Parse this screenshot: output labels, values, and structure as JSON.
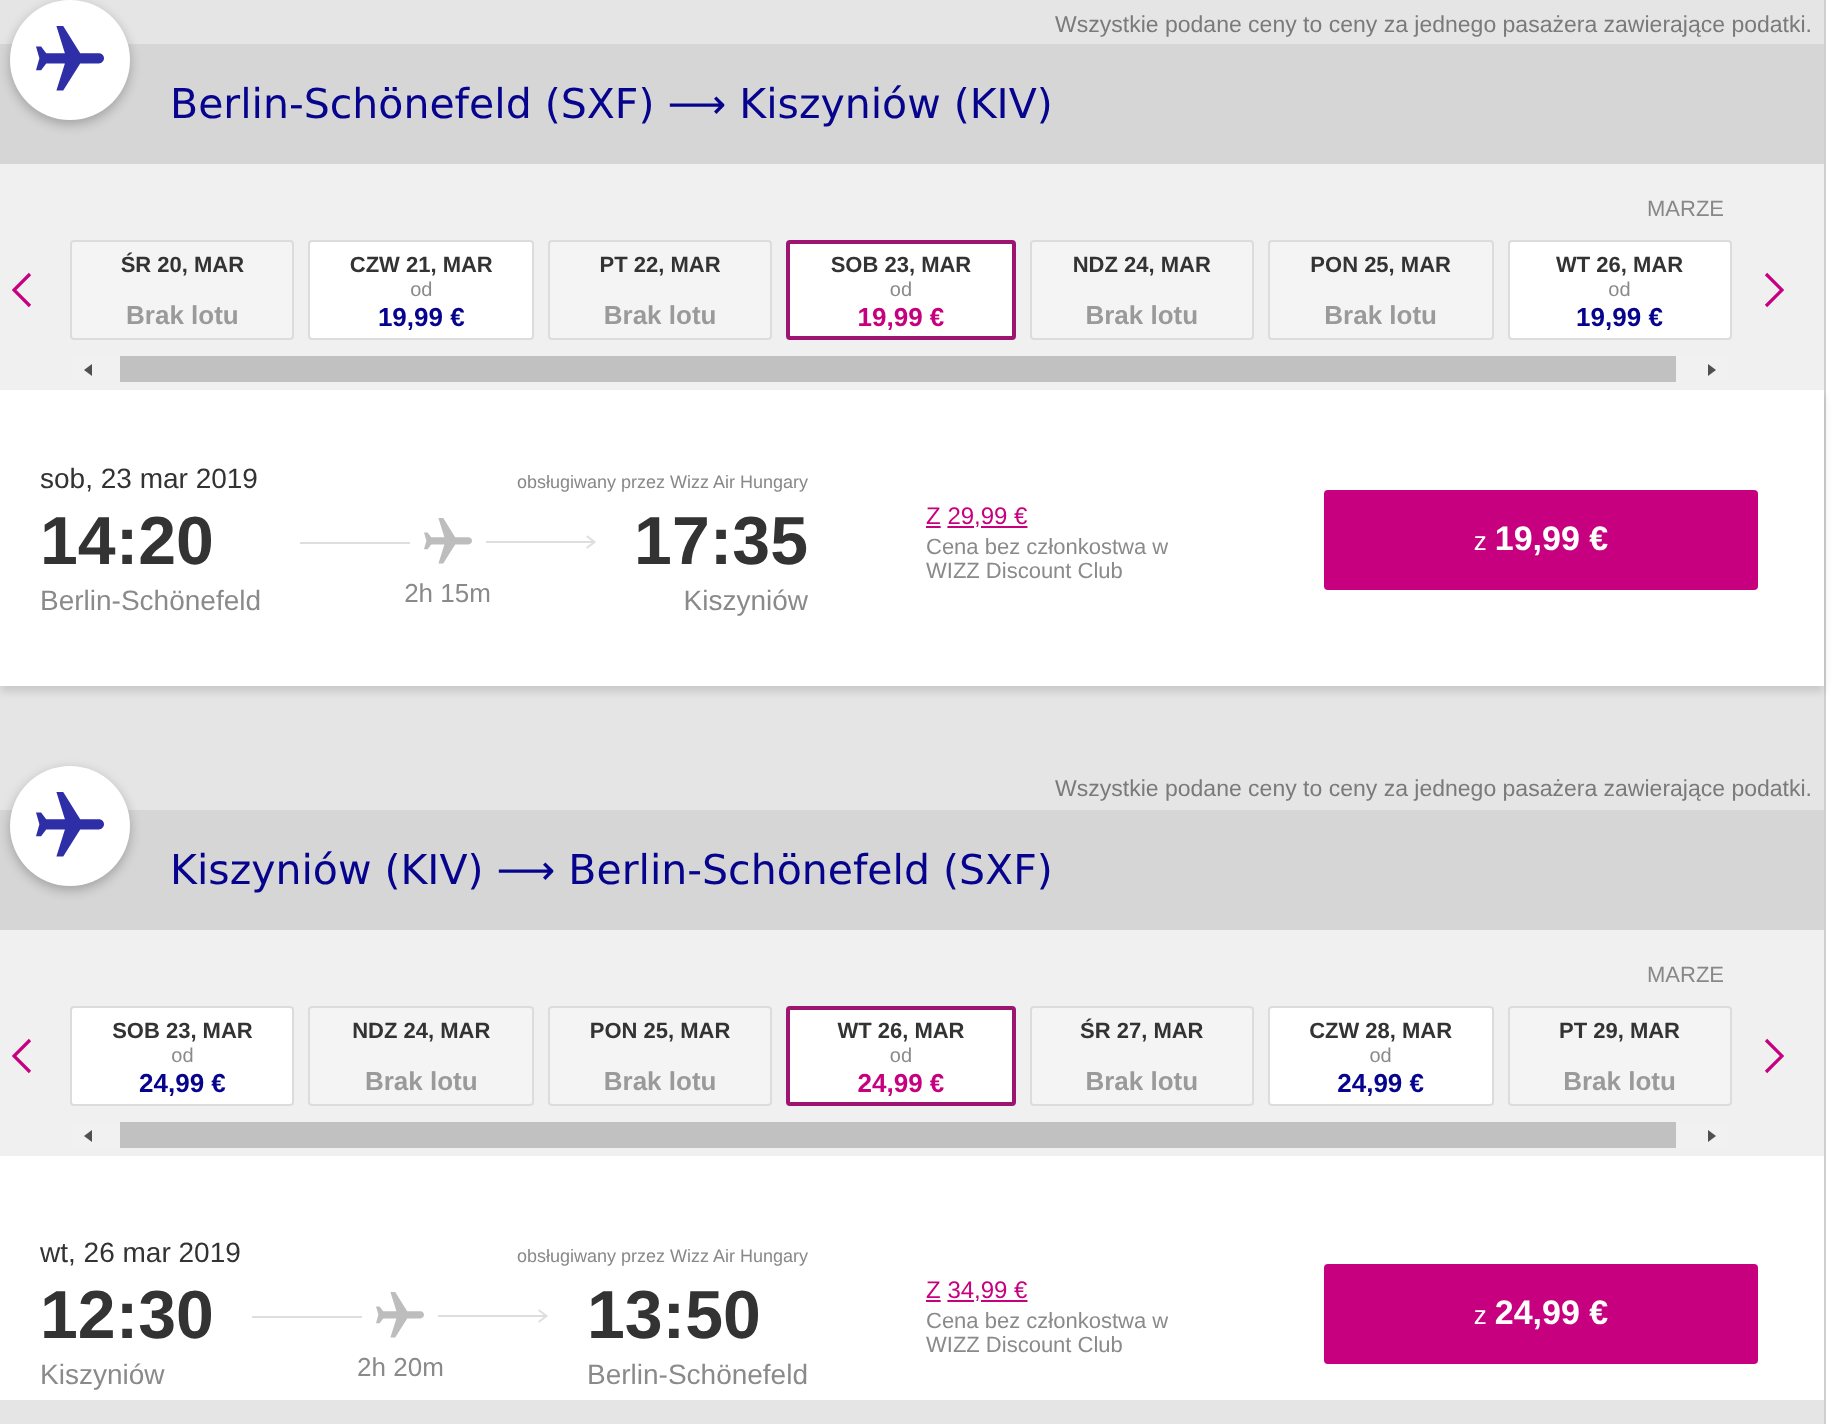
{
  "sections": [
    {
      "notice": "Wszystkie podane ceny to ceny za jednego pasażera zawierające podatki.",
      "route_title": "Berlin-Schönefeld (SXF) ⟶ Kiszyniów (KIV)",
      "month": "MARZE",
      "dates": [
        {
          "kind": "no-flight",
          "date": "ŚR 20, MAR",
          "label": "Brak lotu",
          "selected": false
        },
        {
          "kind": "fare",
          "date": "CZW 21, MAR",
          "from": "od",
          "price": "19,99 €",
          "selected": false
        },
        {
          "kind": "no-flight",
          "date": "PT 22, MAR",
          "label": "Brak lotu",
          "selected": false
        },
        {
          "kind": "fare",
          "date": "SOB 23, MAR",
          "from": "od",
          "price": "19,99 €",
          "selected": true
        },
        {
          "kind": "no-flight",
          "date": "NDZ 24, MAR",
          "label": "Brak lotu",
          "selected": false
        },
        {
          "kind": "no-flight",
          "date": "PON 25, MAR",
          "label": "Brak lotu",
          "selected": false
        },
        {
          "kind": "fare",
          "date": "WT 26, MAR",
          "from": "od",
          "price": "19,99 €",
          "selected": false
        }
      ],
      "flight": {
        "date": "sob, 23 mar 2019",
        "operator": "obsługiwany przez Wizz Air Hungary",
        "departure_time": "14:20",
        "departure_city": "Berlin-Schönefeld",
        "duration": "2h 15m",
        "arrival_time": "17:35",
        "arrival_city": "Kiszyniów",
        "nonmember_prefix": "Z",
        "nonmember_price": "29,99 €",
        "nonmember_note": "Cena bez członkostwa w WIZZ Discount Club",
        "button_prefix": "z",
        "button_price": "19,99 €"
      }
    },
    {
      "notice": "Wszystkie podane ceny to ceny za jednego pasażera zawierające podatki.",
      "route_title": "Kiszyniów (KIV) ⟶ Berlin-Schönefeld (SXF)",
      "month": "MARZE",
      "dates": [
        {
          "kind": "fare",
          "date": "SOB 23, MAR",
          "from": "od",
          "price": "24,99 €",
          "selected": false
        },
        {
          "kind": "no-flight",
          "date": "NDZ 24, MAR",
          "label": "Brak lotu",
          "selected": false
        },
        {
          "kind": "no-flight",
          "date": "PON 25, MAR",
          "label": "Brak lotu",
          "selected": false
        },
        {
          "kind": "fare",
          "date": "WT 26, MAR",
          "from": "od",
          "price": "24,99 €",
          "selected": true
        },
        {
          "kind": "no-flight",
          "date": "ŚR 27, MAR",
          "label": "Brak lotu",
          "selected": false
        },
        {
          "kind": "fare",
          "date": "CZW 28, MAR",
          "from": "od",
          "price": "24,99 €",
          "selected": false
        },
        {
          "kind": "no-flight",
          "date": "PT 29, MAR",
          "label": "Brak lotu",
          "selected": false
        }
      ],
      "flight": {
        "date": "wt, 26 mar 2019",
        "operator": "obsługiwany przez Wizz Air Hungary",
        "departure_time": "12:30",
        "departure_city": "Kiszyniów",
        "duration": "2h 20m",
        "arrival_time": "13:50",
        "arrival_city": "Berlin-Schönefeld",
        "nonmember_prefix": "Z",
        "nonmember_price": "34,99 €",
        "nonmember_note": "Cena bez członkostwa w WIZZ Discount Club",
        "button_prefix": "z",
        "button_price": "24,99 €"
      }
    }
  ]
}
